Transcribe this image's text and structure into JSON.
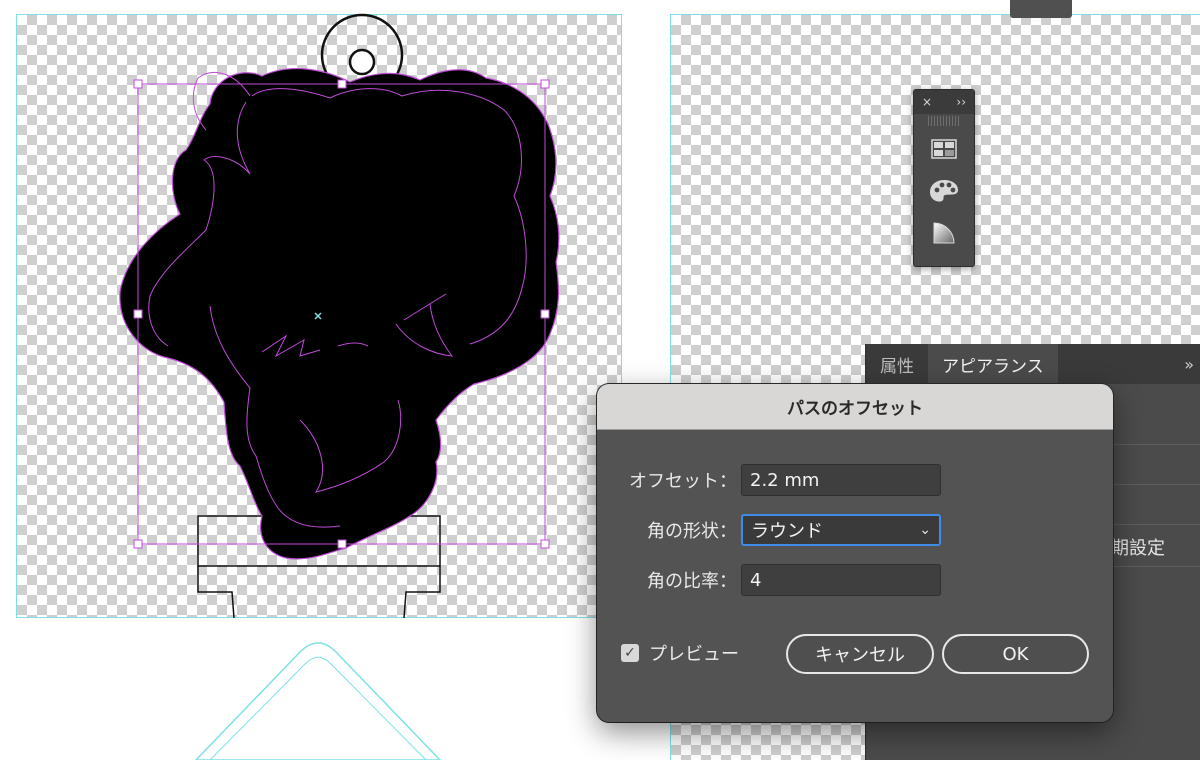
{
  "canvas": {
    "artboard_color": "#7ee0e6",
    "selection_color": "#c04bd8"
  },
  "tool_panel": {
    "close_glyph": "×",
    "expand_glyph": "››",
    "tools": [
      "grid-swatches-icon",
      "palette-icon",
      "gradient-icon"
    ]
  },
  "side_panel": {
    "tabs": [
      "属性",
      "アピアランス"
    ],
    "more_glyph": "»",
    "partial_label": "期設定"
  },
  "dialog": {
    "title": "パスのオフセット",
    "offset_label": "オフセット：",
    "offset_value": "2.2 mm",
    "corner_label": "角の形状：",
    "corner_value": "ラウンド",
    "ratio_label": "角の比率：",
    "ratio_value": "4",
    "preview_label": "プレビュー",
    "preview_checked": true,
    "cancel_label": "キャンセル",
    "ok_label": "OK",
    "accent_color": "#3d8ce8"
  }
}
